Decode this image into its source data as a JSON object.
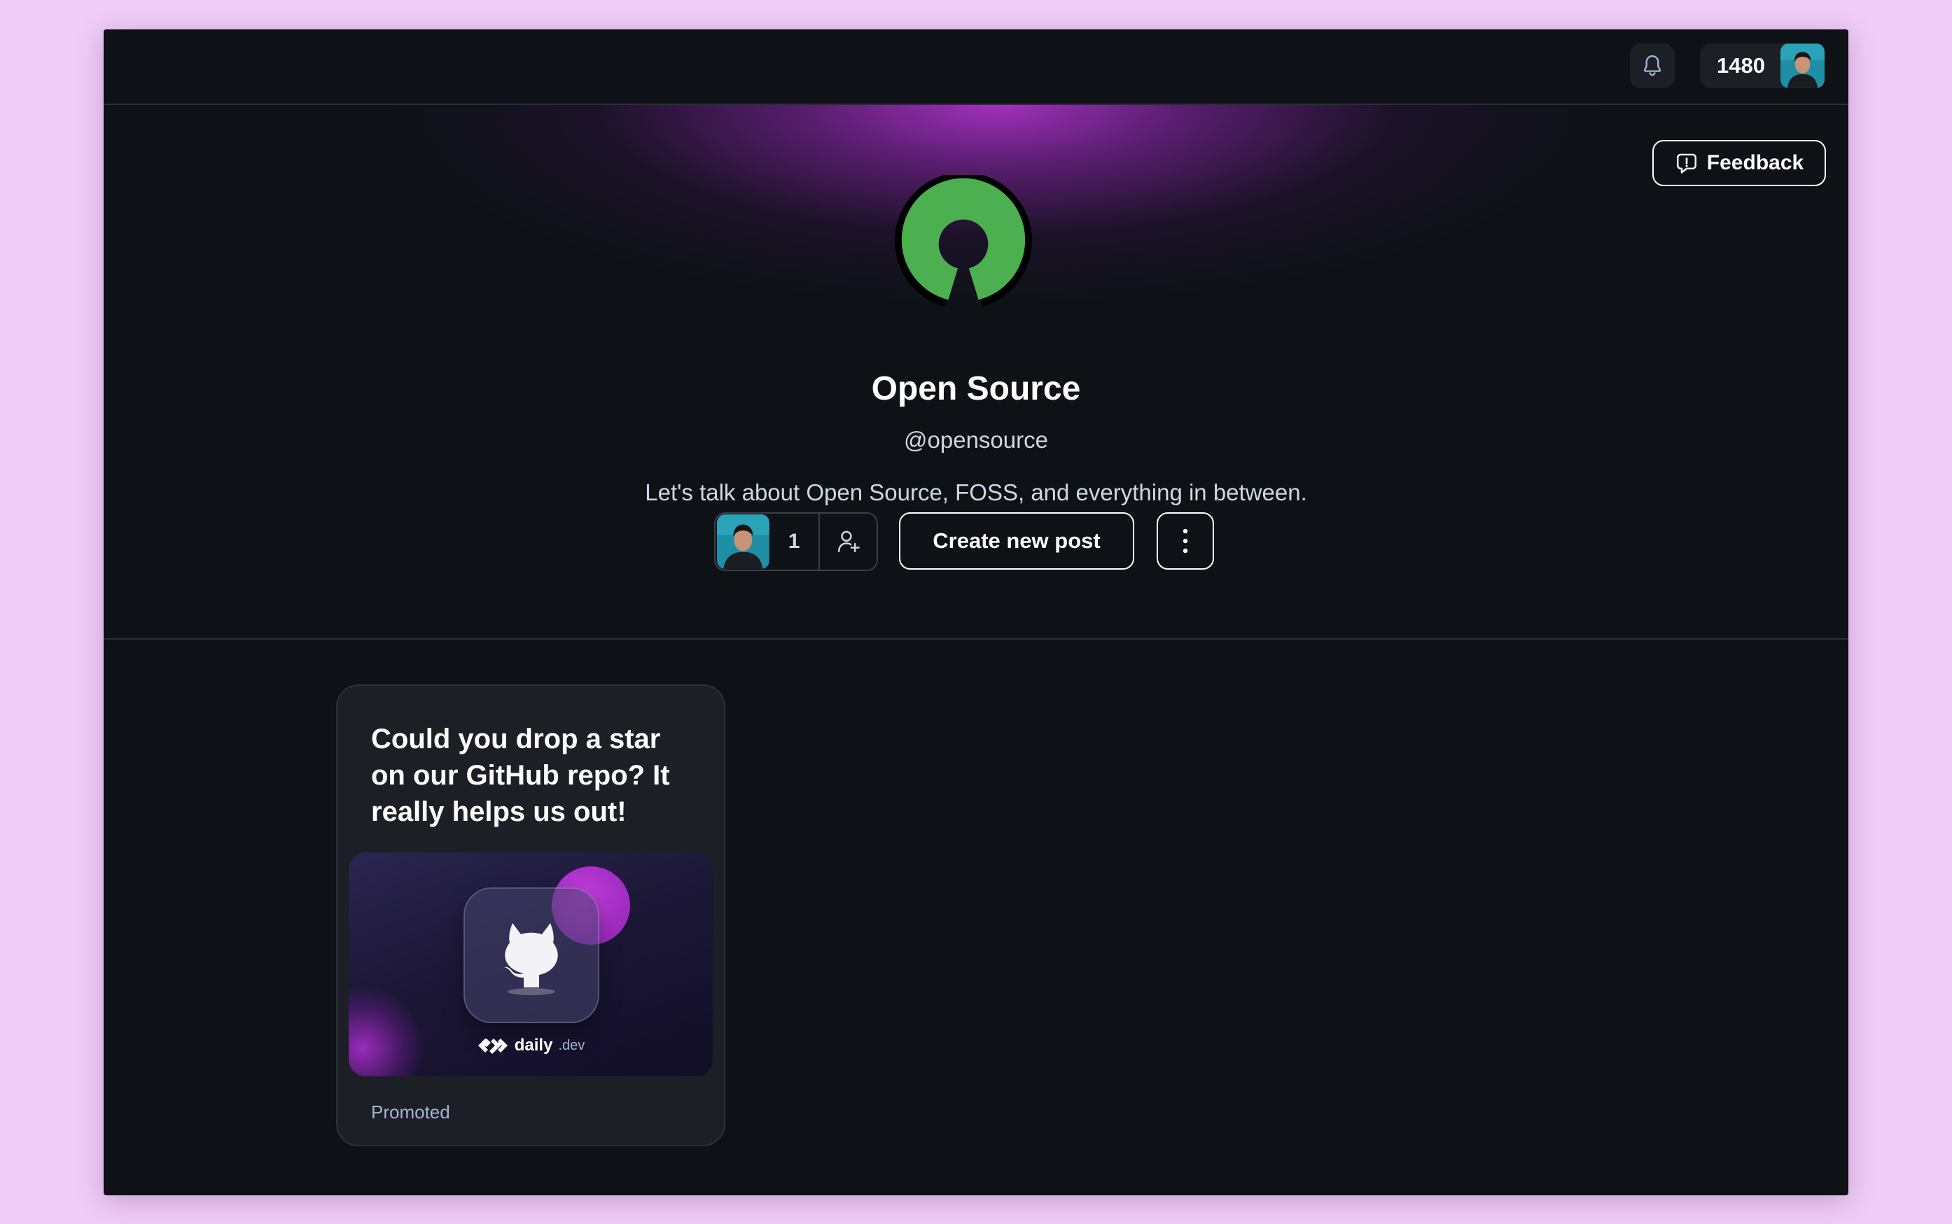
{
  "topbar": {
    "reputation": "1480",
    "notifications_icon": "bell-icon",
    "profile_icon": "user-avatar"
  },
  "feedback": {
    "label": "Feedback",
    "icon": "feedback-bubble-icon"
  },
  "squad": {
    "name": "Open Source",
    "handle": "@opensource",
    "description": "Let's talk about Open Source, FOSS, and everything in between.",
    "logo_icon": "open-source-logo-icon",
    "logo_color": "#4caf50",
    "member_count": "1",
    "invite_icon": "add-member-icon",
    "create_post_label": "Create new post",
    "more_icon": "vertical-ellipsis-icon"
  },
  "colors": {
    "page_background": "#f0cdf7",
    "app_background": "#0e1217",
    "card_background": "#1c1f26",
    "glow": "#a832c4"
  },
  "posts": [
    {
      "title": "Could you drop a star on our GitHub repo? It really helps us out!",
      "image_icon": "github-octocat-icon",
      "image_brand": "daily",
      "image_brand_suffix": ".dev",
      "label": "Promoted"
    }
  ]
}
